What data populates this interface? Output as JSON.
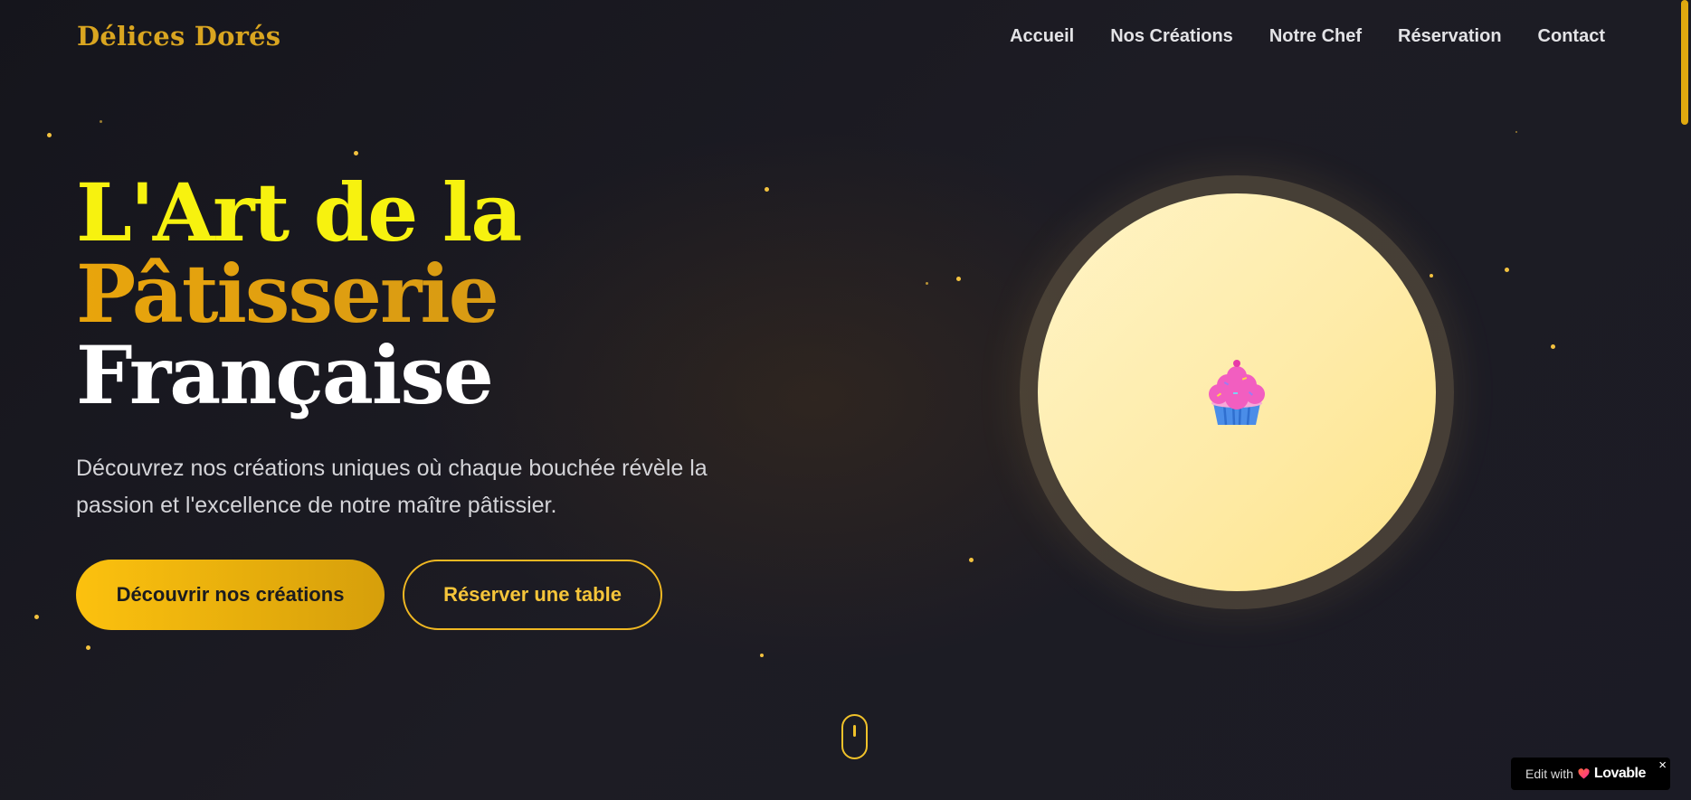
{
  "brand": {
    "name": "Délices Dorés"
  },
  "nav": {
    "links": [
      "Accueil",
      "Nos Créations",
      "Notre Chef",
      "Réservation",
      "Contact"
    ]
  },
  "hero": {
    "title_line1": "L'Art de la",
    "title_line2": "Pâtisserie",
    "title_line3": "Française",
    "description": "Découvrez nos créations uniques où chaque bouchée révèle la passion et l'excellence de notre maître pâtissier.",
    "primary_button": "Découvrir nos créations",
    "secondary_button": "Réserver une table",
    "illustration_icon": "cupcake-icon"
  },
  "badge": {
    "prefix": "Edit with",
    "name": "Lovable",
    "close": "×"
  },
  "colors": {
    "background": "#17171f",
    "gold": "#f0b822",
    "title_yellow": "#f7f20f",
    "disc": "#feeba8"
  }
}
